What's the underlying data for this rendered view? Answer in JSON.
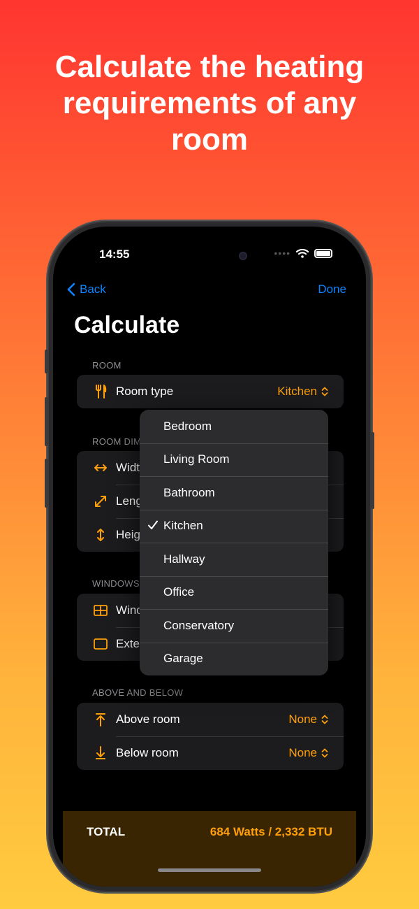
{
  "headline": "Calculate the heating requirements of any room",
  "status": {
    "time": "14:55"
  },
  "nav": {
    "back_label": "Back",
    "done_label": "Done"
  },
  "page_title": "Calculate",
  "sections": {
    "room": {
      "header": "ROOM",
      "rows": [
        {
          "label": "Room type",
          "value": "Kitchen",
          "icon": "fork-knife-icon"
        }
      ]
    },
    "dimensions": {
      "header": "ROOM DIM",
      "rows": [
        {
          "label": "Widt",
          "icon": "horizontal-arrows-icon"
        },
        {
          "label": "Leng",
          "icon": "diagonal-arrows-icon"
        },
        {
          "label": "Heig",
          "icon": "vertical-arrows-icon"
        }
      ]
    },
    "windows": {
      "header": "WINDOWS",
      "rows": [
        {
          "label": "Wind",
          "icon": "window-icon"
        },
        {
          "label": "Exte",
          "icon": "rectangle-icon"
        }
      ]
    },
    "above_below": {
      "header": "ABOVE AND BELOW",
      "rows": [
        {
          "label": "Above room",
          "value": "None",
          "icon": "arrow-up-to-line-icon"
        },
        {
          "label": "Below room",
          "value": "None",
          "icon": "arrow-down-to-line-icon"
        }
      ]
    }
  },
  "dropdown": {
    "selected": "Kitchen",
    "options": [
      "Bedroom",
      "Living Room",
      "Bathroom",
      "Kitchen",
      "Hallway",
      "Office",
      "Conservatory",
      "Garage"
    ]
  },
  "footer": {
    "label": "TOTAL",
    "value": "684 Watts / 2,332 BTU"
  },
  "colors": {
    "accent": "#ff9f0a",
    "link": "#0a84ff",
    "background": "#000000",
    "cell": "#1c1c1e"
  }
}
